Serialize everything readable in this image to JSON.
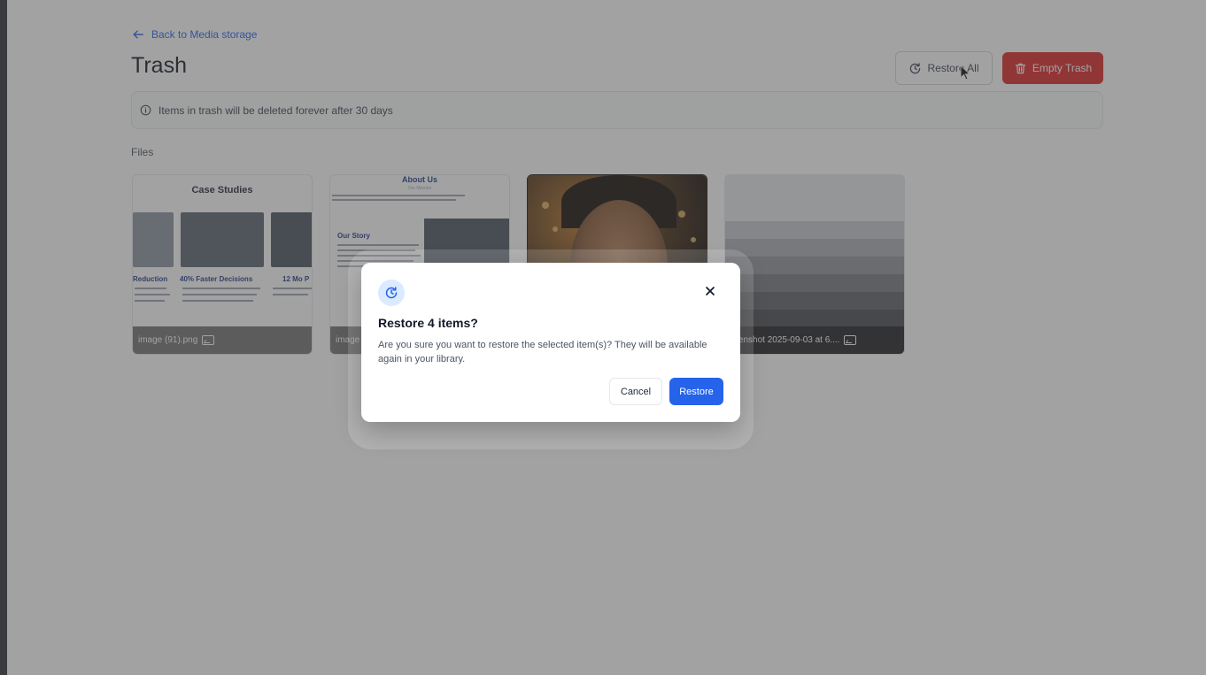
{
  "page": {
    "back_link": "Back to Media storage",
    "title": "Trash",
    "restore_all_label": "Restore All",
    "empty_trash_label": "Empty Trash",
    "info_text": "Items in trash will be deleted forever after 30 days",
    "section_label": "Files"
  },
  "files": [
    {
      "name": "image (91).png",
      "thumb_title": "Case Studies",
      "thumb_headings": [
        "Reduction",
        "40% Faster Decisions",
        "12 Mo P"
      ]
    },
    {
      "name": "image",
      "thumb_title": "About Us",
      "thumb_subtitle": "Our Mission",
      "thumb_heading": "Our Story"
    },
    {
      "name": "",
      "thumb_alt": "portrait photo"
    },
    {
      "name": "reenshot 2025-09-03 at 6...."
    }
  ],
  "dialog": {
    "title": "Restore 4 items?",
    "message": "Are you sure you want to restore the selected item(s)? They will be available again in your library.",
    "cancel_label": "Cancel",
    "confirm_label": "Restore"
  },
  "colors": {
    "accent": "#2563eb",
    "danger": "#dc2626",
    "overlay": "rgba(70,70,70,0.5)"
  },
  "icons": [
    "arrow-left-icon",
    "restore-icon",
    "trash-icon",
    "info-icon",
    "image-icon",
    "close-icon",
    "cursor-icon"
  ]
}
